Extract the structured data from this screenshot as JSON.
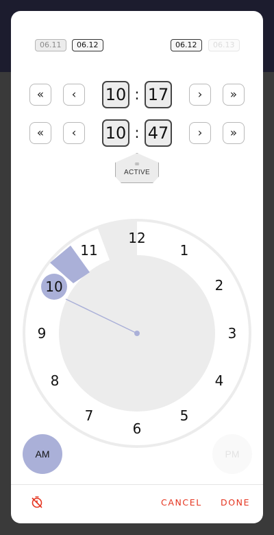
{
  "date_chips": {
    "start_prev": "06.11",
    "start_current": "06.12",
    "end_current": "06.12",
    "end_next": "06.13"
  },
  "start_time": {
    "hour": "10",
    "minute": "17",
    "separator": ":"
  },
  "end_time": {
    "hour": "10",
    "minute": "47",
    "separator": ":"
  },
  "nav_glyphs": {
    "fast_back": "«",
    "back": "‹",
    "forward": "›",
    "fast_forward": "»"
  },
  "active_tag": {
    "small_text": "00",
    "label": "ACTIVE"
  },
  "clock": {
    "numbers": [
      "12",
      "1",
      "2",
      "3",
      "4",
      "5",
      "6",
      "7",
      "8",
      "9",
      "10",
      "11"
    ],
    "selected_hour": "10",
    "accent_color": "#aab0d8"
  },
  "period": {
    "am": "AM",
    "pm": "PM",
    "selected": "AM"
  },
  "footer": {
    "cancel": "CANCEL",
    "done": "DONE",
    "timer_icon": "timer-off-icon",
    "accent_color": "#e5341f"
  }
}
